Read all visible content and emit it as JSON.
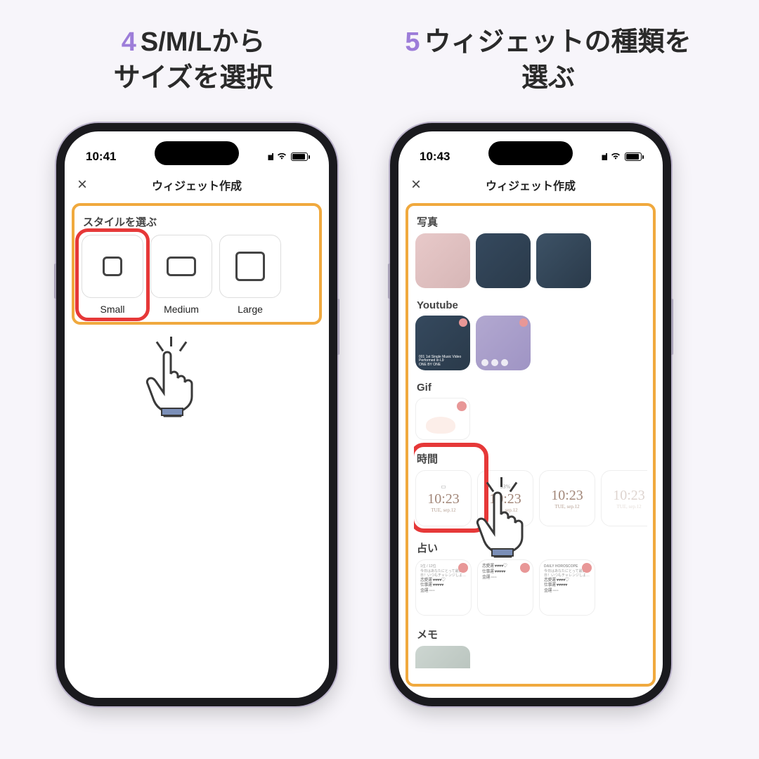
{
  "step4": {
    "num": "4",
    "text_l1": "S/M/Lから",
    "text_l2": "サイズを選択"
  },
  "step5": {
    "num": "5",
    "text_l1": "ウィジェットの種類を",
    "text_l2": "選ぶ"
  },
  "phone_left": {
    "time": "10:41",
    "header_title": "ウィジェット作成",
    "close": "×",
    "style_label": "スタイルを選ぶ",
    "sizes": [
      {
        "label": "Small"
      },
      {
        "label": "Medium"
      },
      {
        "label": "Large"
      }
    ]
  },
  "phone_right": {
    "time": "10:43",
    "header_title": "ウィジェット作成",
    "close": "×",
    "cat_photo": "写真",
    "cat_youtube": "Youtube",
    "cat_gif": "Gif",
    "cat_time": "時間",
    "cat_fortune": "占い",
    "cat_memo": "メモ",
    "yt_caption": "001 1st Single Music Video Performed in L9",
    "yt_artist": "ONE BY ONE",
    "clock": {
      "time": "10:23",
      "date": "TUE, sep.12",
      "battery": "33%"
    },
    "fortune_rank": "1位 / 12位",
    "fortune_body": "今日はあなたにとって最高の日！いつもチャレンジしよ…",
    "fortune_title2": "DAILY HOROSCOPE",
    "fortune_rows": [
      "恋愛運",
      "仕事運",
      "金運"
    ]
  }
}
